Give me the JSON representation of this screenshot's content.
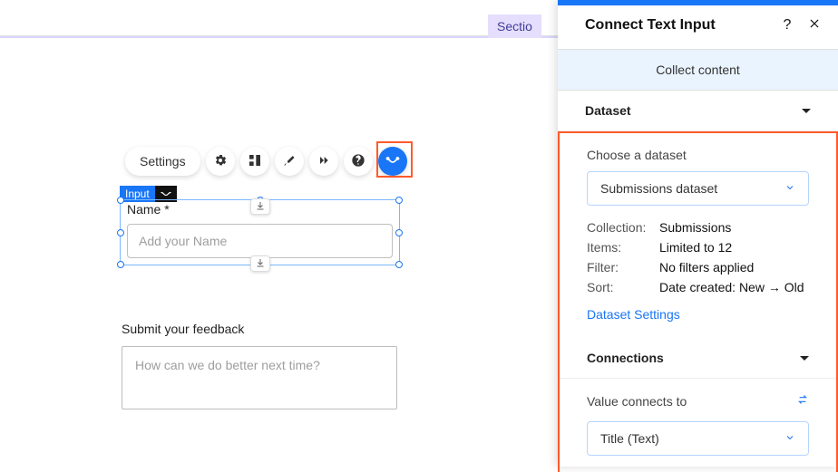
{
  "topbar": {
    "section_badge": "Sectio"
  },
  "toolbar": {
    "settings_label": "Settings"
  },
  "selected_element": {
    "tag": "Input",
    "field_label": "Name *",
    "placeholder": "Add your Name"
  },
  "feedback": {
    "label": "Submit your feedback",
    "placeholder": "How can we do better next time?"
  },
  "panel": {
    "title": "Connect Text Input",
    "collect_banner": "Collect content",
    "dataset_section": "Dataset",
    "choose_label": "Choose a dataset",
    "dataset_select": "Submissions dataset",
    "meta": {
      "collection_label": "Collection:",
      "collection_value": "Submissions",
      "items_label": "Items:",
      "items_value": "Limited to 12",
      "filter_label": "Filter:",
      "filter_value": "No filters applied",
      "sort_label": "Sort:",
      "sort_value": "Date created: New → Old"
    },
    "settings_link": "Dataset Settings",
    "connections_section": "Connections",
    "value_connects_label": "Value connects to",
    "value_select": "Title (Text)"
  }
}
